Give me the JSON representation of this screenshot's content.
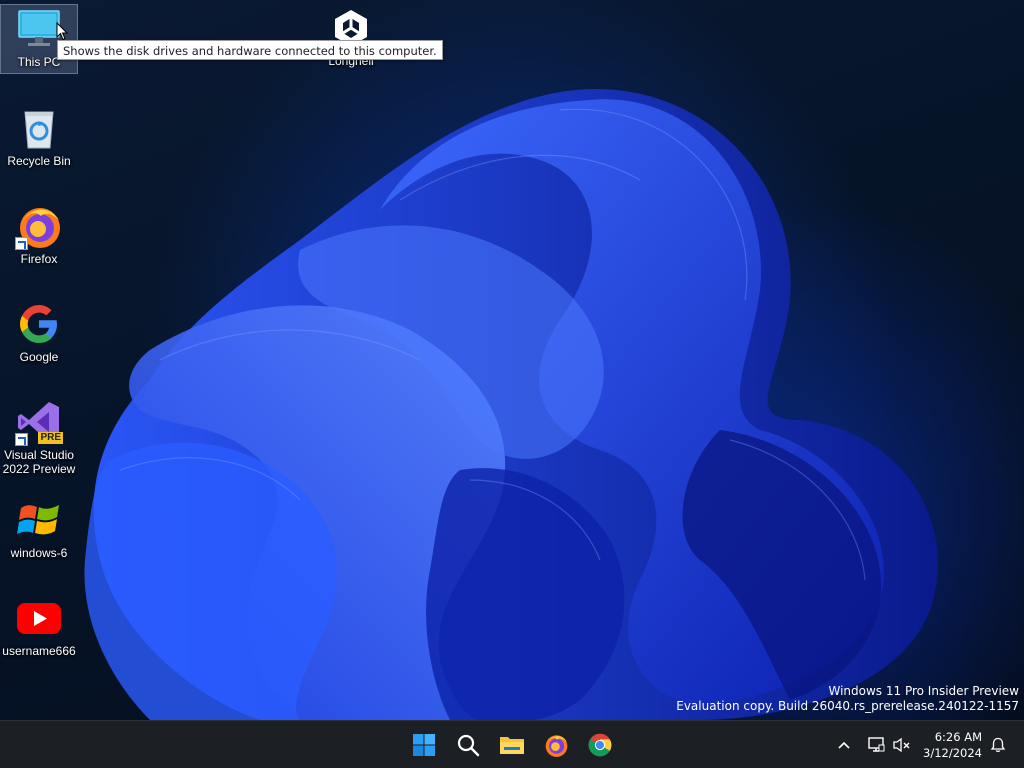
{
  "desktop": {
    "icons": [
      {
        "name": "This PC",
        "icon": "monitor-icon"
      },
      {
        "name": "Recycle Bin",
        "icon": "recycle-bin-icon"
      },
      {
        "name": "Firefox",
        "icon": "firefox-icon"
      },
      {
        "name": "Google",
        "icon": "google-icon"
      },
      {
        "name": "Visual Studio",
        "name2": "2022 Preview",
        "icon": "visual-studio-icon",
        "badge": "PRE"
      },
      {
        "name": "windows-6",
        "icon": "windows-flag-icon"
      },
      {
        "name": "username666",
        "icon": "youtube-icon"
      },
      {
        "name": "Longhell",
        "icon": "unity-icon"
      }
    ],
    "tooltip": "Shows the disk drives and hardware connected to this computer."
  },
  "watermark": {
    "line1": "Windows 11 Pro Insider Preview",
    "line2": "Evaluation copy. Build 26040.rs_prerelease.240122-1157"
  },
  "taskbar": {
    "apps": [
      "start-icon",
      "search-icon",
      "file-explorer-icon",
      "firefox-icon",
      "chrome-icon"
    ],
    "tray": {
      "time": "6:26 AM",
      "date": "3/12/2024",
      "icons": [
        "chevron-up-icon",
        "network-icon",
        "volume-muted-icon",
        "notification-bell-icon"
      ]
    }
  },
  "colors": {
    "taskbar": "#1c1f24",
    "wallpaper_blue": "#1f4bff",
    "start_blue": "#2a9df4"
  }
}
